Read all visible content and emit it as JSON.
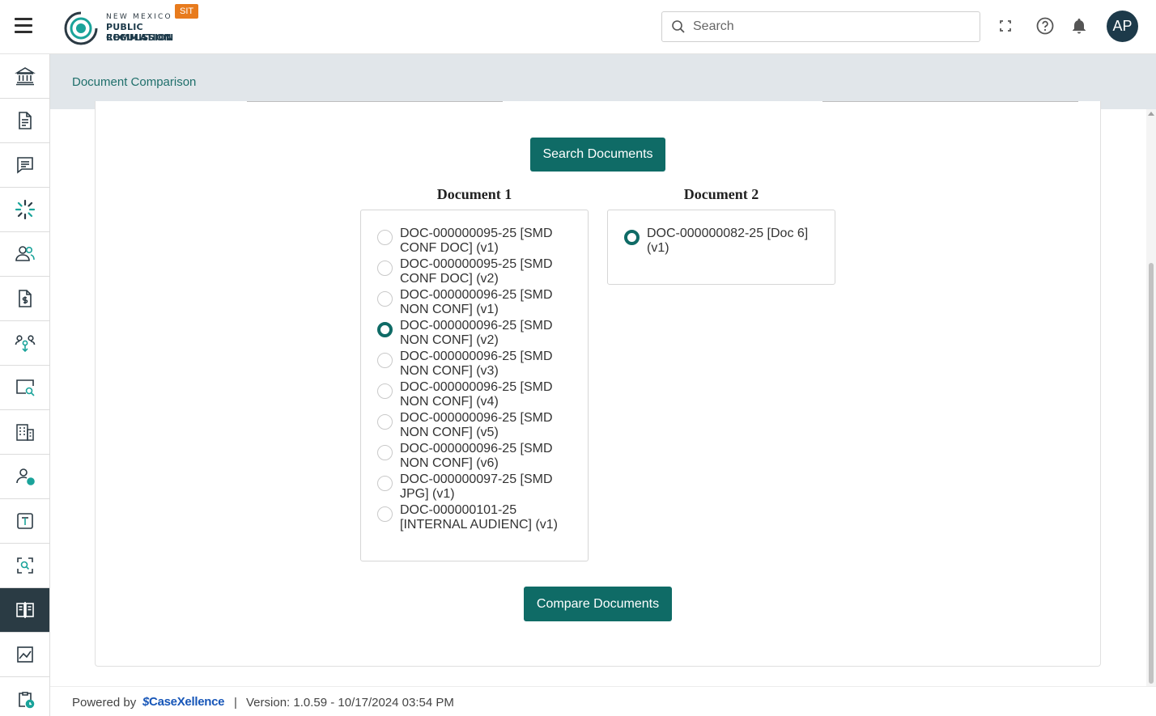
{
  "header": {
    "logo_line1": "NEW MEXICO",
    "logo_line2": "PUBLIC REGULATION",
    "logo_line3": "COMMISSION",
    "env_badge": "SIT",
    "search_placeholder": "Search",
    "avatar_initials": "AP"
  },
  "sidebar": {
    "items": [
      {
        "icon": "institution-icon",
        "active": false
      },
      {
        "icon": "document-icon",
        "active": false
      },
      {
        "icon": "comment-icon",
        "active": false
      },
      {
        "icon": "burst-icon",
        "active": false
      },
      {
        "icon": "people-icon",
        "active": false
      },
      {
        "icon": "invoice-icon",
        "active": false
      },
      {
        "icon": "group-share-icon",
        "active": false
      },
      {
        "icon": "screen-search-icon",
        "active": false
      },
      {
        "icon": "building-icon",
        "active": false
      },
      {
        "icon": "user-status-icon",
        "active": false
      },
      {
        "icon": "text-box-icon",
        "active": false
      },
      {
        "icon": "scan-search-icon",
        "active": false
      },
      {
        "icon": "compare-book-icon",
        "active": true
      },
      {
        "icon": "chart-image-icon",
        "active": false
      },
      {
        "icon": "clipboard-clock-icon",
        "active": false
      }
    ]
  },
  "breadcrumb": {
    "current": "Document Comparison"
  },
  "main": {
    "search_button": "Search Documents",
    "doc1_title": "Document 1",
    "doc2_title": "Document 2",
    "doc1_options": [
      {
        "label": "DOC-000000095-25 [SMD CONF DOC] (v1)",
        "checked": false
      },
      {
        "label": "DOC-000000095-25 [SMD CONF DOC] (v2)",
        "checked": false
      },
      {
        "label": "DOC-000000096-25 [SMD NON CONF] (v1)",
        "checked": false
      },
      {
        "label": "DOC-000000096-25 [SMD NON CONF] (v2)",
        "checked": true
      },
      {
        "label": "DOC-000000096-25 [SMD NON CONF] (v3)",
        "checked": false
      },
      {
        "label": "DOC-000000096-25 [SMD NON CONF] (v4)",
        "checked": false
      },
      {
        "label": "DOC-000000096-25 [SMD NON CONF] (v5)",
        "checked": false
      },
      {
        "label": "DOC-000000096-25 [SMD NON CONF] (v6)",
        "checked": false
      },
      {
        "label": "DOC-000000097-25 [SMD JPG] (v1)",
        "checked": false
      },
      {
        "label": "DOC-000000101-25 [INTERNAL AUDIENC] (v1)",
        "checked": false
      }
    ],
    "doc2_options": [
      {
        "label": "DOC-000000082-25 [Doc 6] (v1)",
        "checked": true
      }
    ],
    "compare_button": "Compare Documents"
  },
  "footer": {
    "powered_by": "Powered by",
    "brand": "CaseXellence",
    "separator": "|",
    "version": "Version: 1.0.59 - 10/17/2024 03:54 PM"
  },
  "colors": {
    "accent": "#0f6b66",
    "sidebar_active": "#2a3b44",
    "breadcrumb_band": "#e1e6ea",
    "env_badge": "#e87b1d"
  }
}
